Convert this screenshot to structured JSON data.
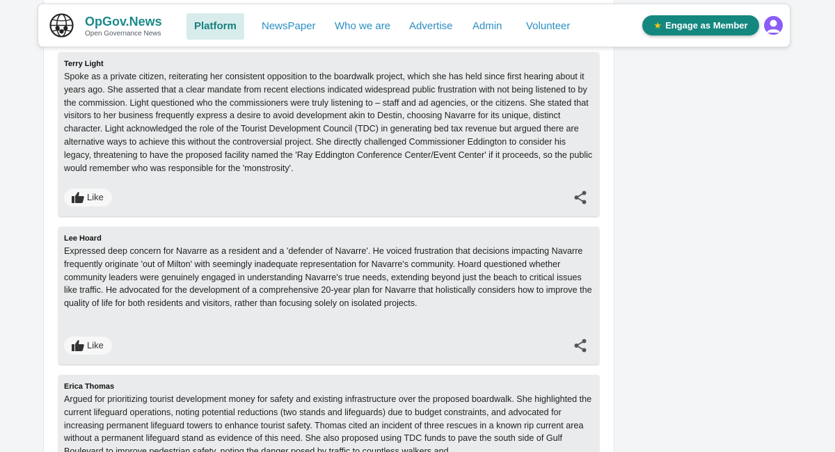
{
  "brand": {
    "name": "OpGov.News",
    "tagline": "Open Governance News"
  },
  "nav": {
    "items": [
      "Platform",
      "NewsPaper",
      "Who we are",
      "Advertise",
      "Admin",
      "Volunteer"
    ],
    "active": "Platform"
  },
  "member_button": {
    "label": "Engage as Member",
    "icon": "star-icon"
  },
  "comments": [
    {
      "name": "Terry Light",
      "text": "Spoke as a private citizen, reiterating her consistent opposition to the boardwalk project, which she has held since first hearing about it years ago. She asserted that a clear mandate from recent elections indicated widespread public frustration with not being listened to by the commission. Light questioned who the commissioners were truly listening to – staff and ad agencies, or the citizens. She stated that visitors to her business frequently express a desire to avoid development akin to Destin, choosing Navarre for its unique, distinct character. Light acknowledged the role of the Tourist Development Council (TDC) in generating bed tax revenue but argued there are alternative ways to achieve this without the controversial project. She directly challenged Commissioner Eddington to consider his legacy, threatening to have the proposed facility named the 'Ray Eddington Conference Center/Event Center' if it proceeds, so the public would remember who was responsible for the 'monstrosity'.",
      "like_label": "Like"
    },
    {
      "name": "Lee Hoard",
      "text": "Expressed deep concern for Navarre as a resident and a 'defender of Navarre'. He voiced frustration that decisions impacting Navarre frequently originate 'out of Milton' with seemingly inadequate representation for Navarre's community. Hoard questioned whether community leaders were genuinely engaged in understanding Navarre's true needs, extending beyond just the beach to critical issues like traffic. He advocated for the development of a comprehensive 20-year plan for Navarre that holistically considers how to improve the quality of life for both residents and visitors, rather than focusing solely on isolated projects.",
      "like_label": "Like"
    },
    {
      "name": "Erica Thomas",
      "text": "Argued for prioritizing tourist development money for safety and existing infrastructure over the proposed boardwalk. She highlighted the current lifeguard operations, noting potential reductions (two stands and lifeguards) due to budget constraints, and advocated for increasing permanent lifeguard towers to enhance tourist safety. Thomas cited an incident of three rescues in a known rip current area without a permanent lifeguard stand as evidence of this need. She also proposed using TDC funds to pave the south side of Gulf Boulevard to improve pedestrian safety, noting the danger posed by traffic to countless walkers and",
      "like_label": "Like"
    }
  ],
  "colors": {
    "brand": "#1b8a8c",
    "nav_link": "#2b8fc2",
    "member_button": "#14877f",
    "avatar": "#8b5cf6",
    "card_bg": "#eaebec"
  }
}
